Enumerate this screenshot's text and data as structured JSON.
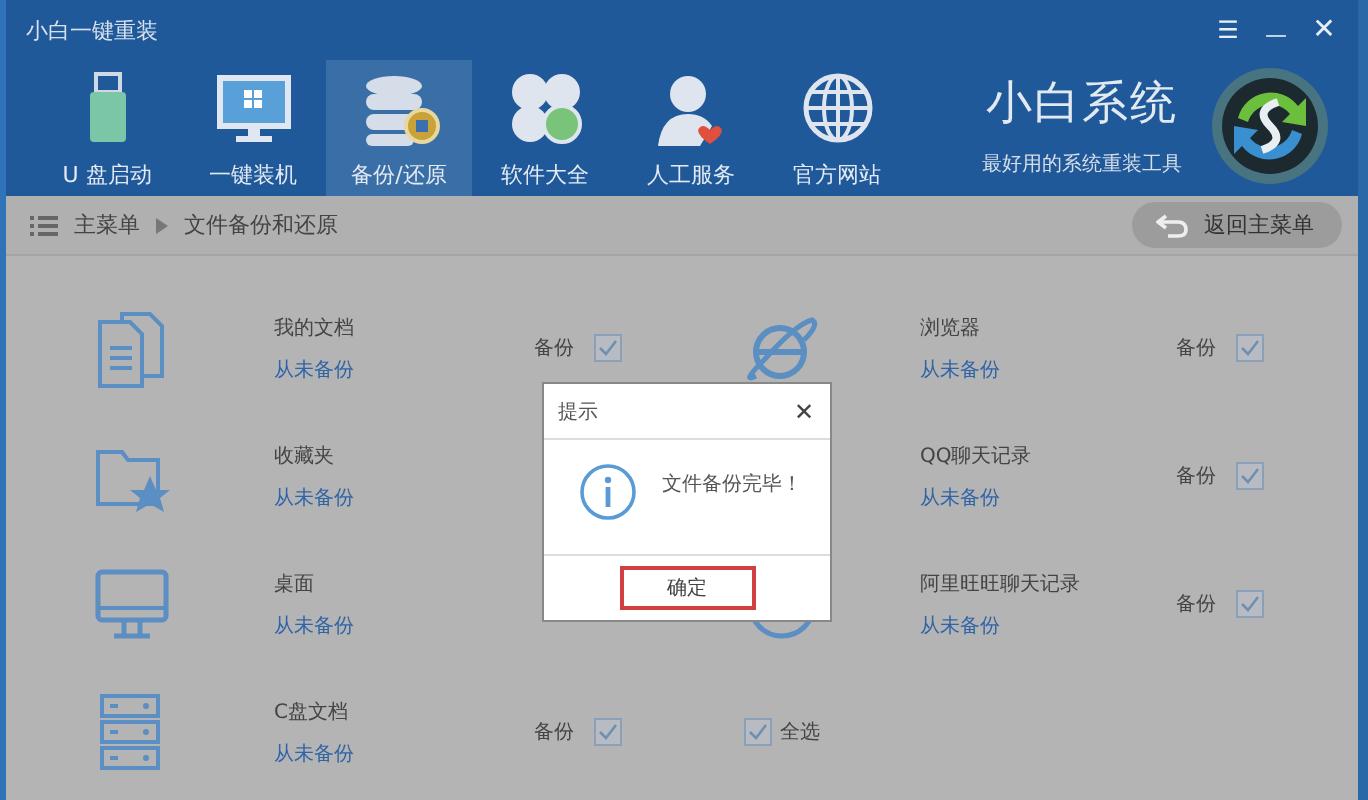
{
  "window": {
    "title": "小白一键重装",
    "controls": [
      {
        "kind": "menu",
        "label": "☰"
      },
      {
        "kind": "minimize",
        "label": "—"
      },
      {
        "kind": "close",
        "label": "✕"
      }
    ]
  },
  "nav": [
    {
      "kind": "usb",
      "label": "U 盘启动",
      "selected": false
    },
    {
      "kind": "monitor",
      "label": "一键装机",
      "selected": false
    },
    {
      "kind": "database",
      "label": "备份/还原",
      "selected": true
    },
    {
      "kind": "clover",
      "label": "软件大全",
      "selected": false
    },
    {
      "kind": "person",
      "label": "人工服务",
      "selected": false
    },
    {
      "kind": "globe",
      "label": "官方网站",
      "selected": false
    }
  ],
  "brand": {
    "name": "小白系统",
    "slogan": "最好用的系统重装工具"
  },
  "breadcrumb": {
    "items": [
      "主菜单",
      "文件备份和还原"
    ],
    "back_button": "返回主菜单"
  },
  "left_items": [
    {
      "kind": "documents",
      "name": "我的文档",
      "status": "从未备份",
      "backup": {
        "label": "备份",
        "checked": true
      }
    },
    {
      "kind": "favorites",
      "name": "收藏夹",
      "status": "从未备份"
    },
    {
      "kind": "desktop",
      "name": "桌面",
      "status": "从未备份"
    },
    {
      "kind": "drive",
      "name": "C盘文档",
      "status": "从未备份",
      "backup": {
        "label": "备份",
        "checked": true
      }
    }
  ],
  "right_items": [
    {
      "kind": "browser",
      "name": "浏览器",
      "status": "从未备份",
      "backup": {
        "label": "备份",
        "checked": true
      }
    },
    {
      "name": "QQ聊天记录",
      "status": "从未备份",
      "backup": {
        "label": "备份",
        "checked": true
      }
    },
    {
      "kind": "chat-round",
      "name": "阿里旺旺聊天记录",
      "status": "从未备份",
      "backup": {
        "label": "备份",
        "checked": true
      }
    }
  ],
  "select_all": {
    "label": "全选",
    "checked": true
  },
  "dialog": {
    "title": "提示",
    "close": "✕",
    "message": "文件备份完毕！",
    "button": "确定"
  }
}
